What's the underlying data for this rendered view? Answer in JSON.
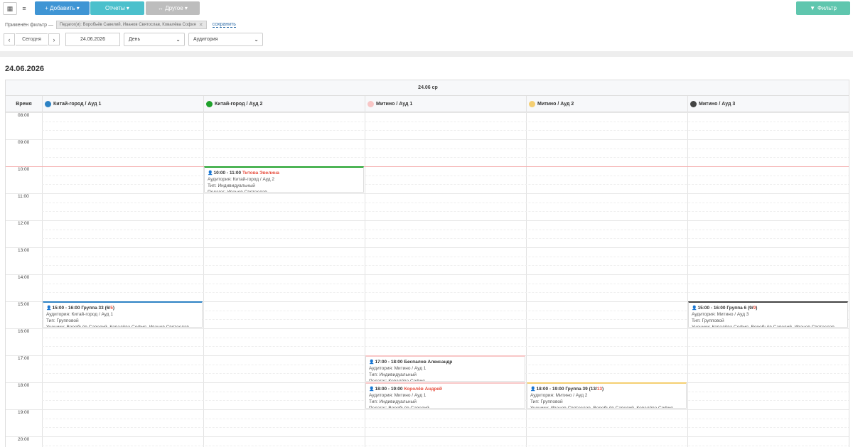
{
  "toolbar": {
    "add_label": "+ Добавить ▾",
    "reports_label": "Отчеты ▾",
    "other_label": "↔ Другое ▾",
    "filter_label": "Фильтр"
  },
  "filter_bar": {
    "applied_label": "Применён фильтр —",
    "tag_text": "Педагог(и): Воробьёв Савелий, Иванов Святослав, Ковалёва София",
    "save_label": "сохранить"
  },
  "navigation": {
    "today_label": "Сегодня",
    "date_value": "24.06.2026",
    "view_value": "День",
    "group_value": "Аудитория"
  },
  "page_date": "24.06.2026",
  "calendar": {
    "day_header": "24.06 ср",
    "time_col_label": "Время",
    "columns": [
      {
        "label": "Китай-город / Ауд 1",
        "color": "#2d82c4"
      },
      {
        "label": "Китай-город / Ауд 2",
        "color": "#1fa12b"
      },
      {
        "label": "Митино / Ауд 1",
        "color": "#f8c6c6"
      },
      {
        "label": "Митино / Ауд 2",
        "color": "#f5cf72"
      },
      {
        "label": "Митино / Ауд 3",
        "color": "#444444"
      }
    ],
    "times": [
      "08:00",
      "09:00",
      "10:00",
      "11:00",
      "12:00",
      "13:00",
      "14:00",
      "15:00",
      "16:00",
      "17:00",
      "18:00",
      "19:00",
      "20:00"
    ],
    "events": [
      {
        "time": "10:00 - 11:00",
        "name": "Титова Эвелина",
        "name_red": true,
        "count": "",
        "count_red": "",
        "room": "Аудитория: Китай-город / Ауд 2",
        "type": "Тип: Индивидуальный",
        "extra": "Педагог: Иванов Святослав"
      },
      {
        "time": "15:00 - 16:00",
        "name": "Группа 33",
        "name_red": false,
        "count": "(6/",
        "count_red": "5",
        "room": "Аудитория: Китай-город / Ауд 1",
        "type": "Тип: Групповой",
        "extra": "Ученики: Воробьёв Савелий, Ковалёва София, Иванов Святослав"
      },
      {
        "time": "15:00 - 16:00",
        "name": "Группа 6",
        "name_red": false,
        "count": "(9/",
        "count_red": "9",
        "room": "Аудитория: Митино / Ауд 3",
        "type": "Тип: Групповой",
        "extra": "Ученики: Ковалёва София, Воробьёв Савелий, Иванов Святослав"
      },
      {
        "time": "17:00 - 18:00",
        "name": "Беспалов Александр",
        "name_red": false,
        "count": "",
        "count_red": "",
        "room": "Аудитория: Митино / Ауд 1",
        "type": "Тип: Индивидуальный",
        "extra": "Педагог: Ковалёва София"
      },
      {
        "time": "18:00 - 19:00",
        "name": "Королёв Андрей",
        "name_red": true,
        "count": "",
        "count_red": "",
        "room": "Аудитория: Митино / Ауд 1",
        "type": "Тип: Индивидуальный",
        "extra": "Педагог: Воробьёв Савелий"
      },
      {
        "time": "18:00 - 19:00",
        "name": "Группа 39",
        "name_red": false,
        "count": "(13/",
        "count_red": "13",
        "room": "Аудитория: Митино / Ауд 2",
        "type": "Тип: Групповой",
        "extra": "Ученики: Иванов Святослав, Воробьёв Савелий, Ковалёва София"
      }
    ]
  }
}
